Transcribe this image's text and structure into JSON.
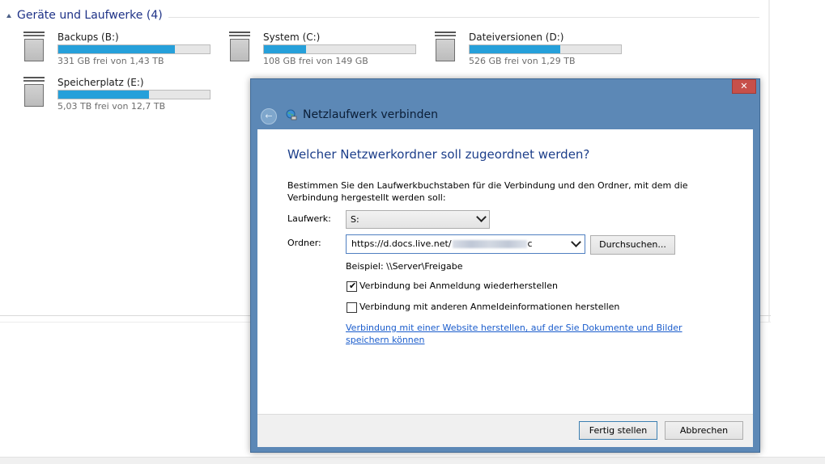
{
  "explorer": {
    "section_title": "Geräte und Laufwerke (4)",
    "drives": [
      {
        "name": "Backups (B:)",
        "free": "331 GB frei von 1,43 TB",
        "used_fraction": 0.77
      },
      {
        "name": "System (C:)",
        "free": "108 GB frei von 149 GB",
        "used_fraction": 0.28
      },
      {
        "name": "Dateiversionen (D:)",
        "free": "526 GB frei von 1,29 TB",
        "used_fraction": 0.6
      },
      {
        "name": "Speicherplatz (E:)",
        "free": "5,03 TB frei von 12,7 TB",
        "used_fraction": 0.6
      }
    ]
  },
  "dialog": {
    "close_symbol": "✕",
    "back_symbol": "←",
    "title": "Netzlaufwerk verbinden",
    "heading": "Welcher Netzwerkordner soll zugeordnet werden?",
    "description": "Bestimmen Sie den Laufwerkbuchstaben für die Verbindung und den Ordner, mit dem die Verbindung hergestellt werden soll:",
    "drive_label": "Laufwerk:",
    "drive_value": "S:",
    "folder_label": "Ordner:",
    "folder_value": "https://d.docs.live.net/",
    "folder_value_end": "c",
    "browse_label": "Durchsuchen...",
    "example": "Beispiel: \\\\Server\\Freigabe",
    "checkbox_reconnect": {
      "label": "Verbindung bei Anmeldung wiederherstellen",
      "checked": true
    },
    "checkbox_credentials": {
      "label": "Verbindung mit anderen Anmeldeinformationen herstellen",
      "checked": false
    },
    "checkmark": "✔",
    "link_text": "Verbindung mit einer Website herstellen, auf der Sie Dokumente und Bilder speichern können",
    "finish_label": "Fertig stellen",
    "cancel_label": "Abbrechen"
  },
  "colors": {
    "drive_bar_fill": "#26a0da",
    "dialog_frame": "#5c88b6",
    "close_button": "#c7504a",
    "heading": "#1c3e8a",
    "link": "#1a5ccc"
  }
}
